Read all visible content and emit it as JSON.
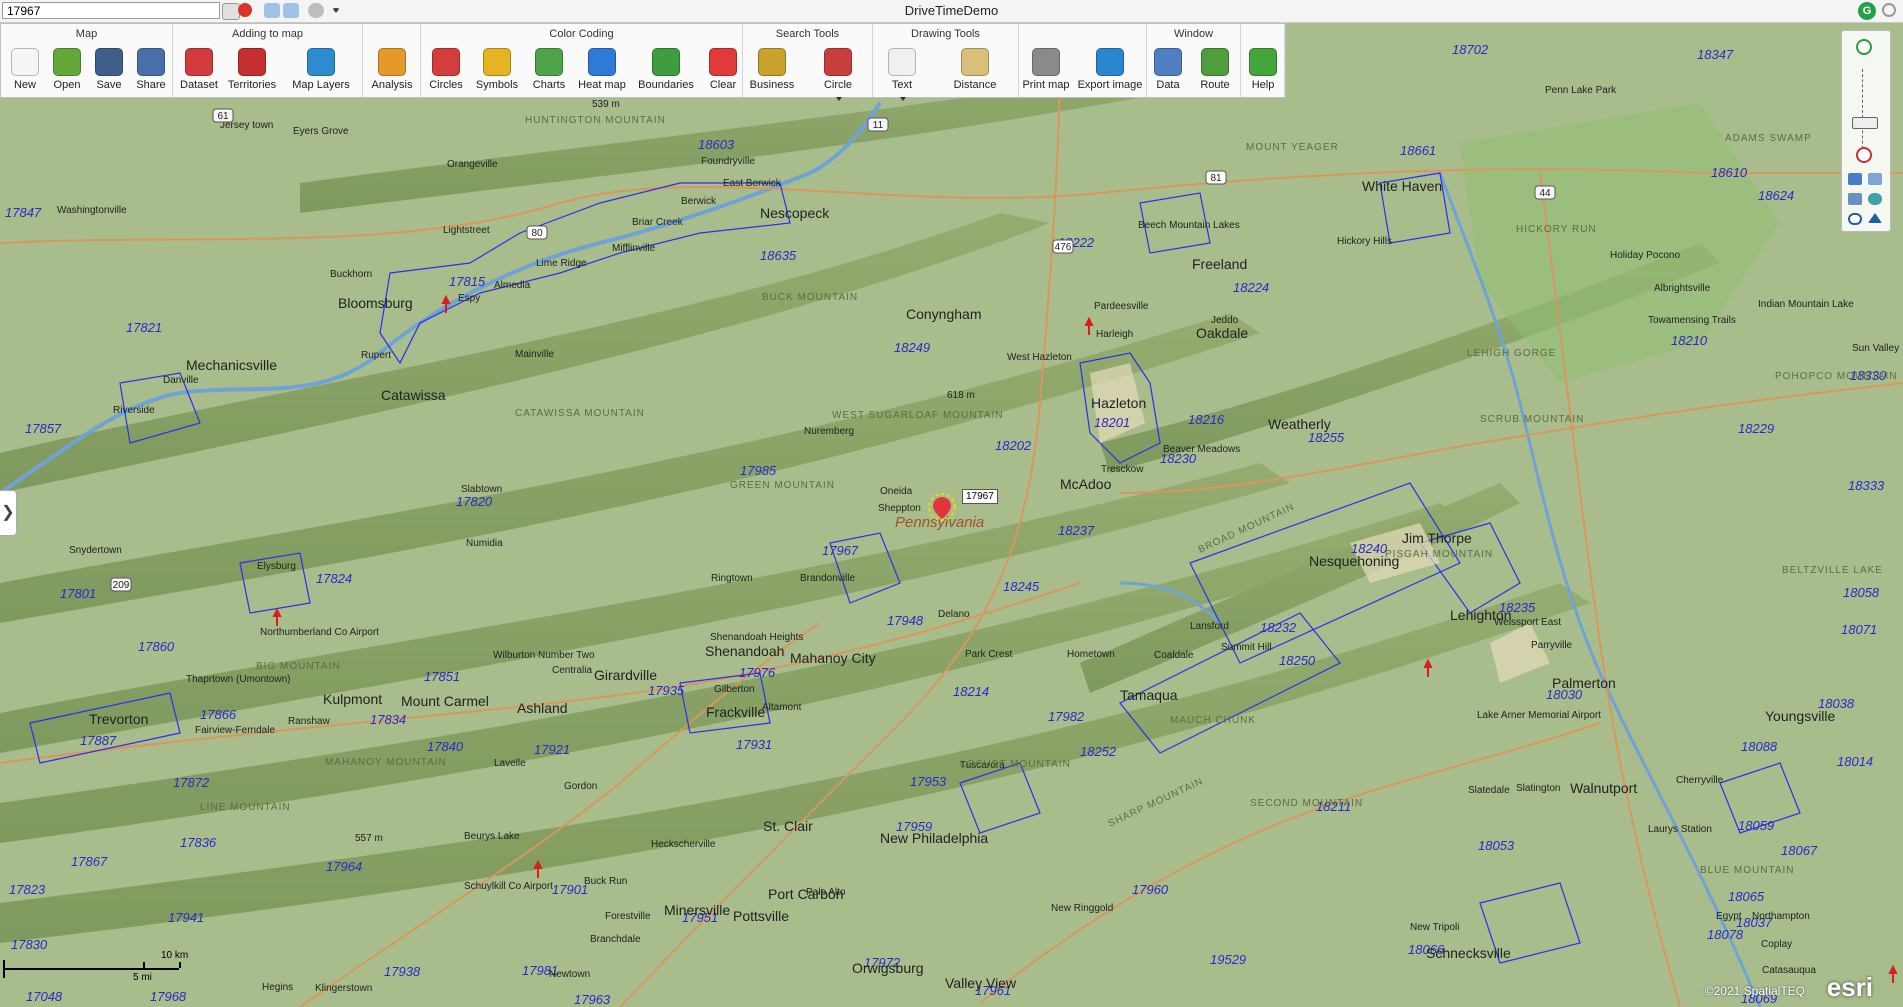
{
  "app": {
    "title": "DriveTimeDemo",
    "user_initial": "G",
    "search_value": "17967"
  },
  "ribbon": {
    "groups": [
      {
        "title": "Map",
        "buttons": [
          "New",
          "Open",
          "Save",
          "Share"
        ]
      },
      {
        "title": "Adding to map",
        "buttons": [
          "Dataset",
          "Territories",
          "Map Layers"
        ]
      },
      {
        "title": "",
        "buttons": [
          "Analysis"
        ]
      },
      {
        "title": "Color Coding",
        "buttons": [
          "Circles",
          "Symbols",
          "Charts",
          "Heat map",
          "Boundaries",
          "Clear"
        ]
      },
      {
        "title": "Search Tools",
        "buttons": [
          "Business",
          "Circle"
        ]
      },
      {
        "title": "Drawing Tools",
        "buttons": [
          "Text",
          "Distance"
        ]
      },
      {
        "title": "",
        "buttons": [
          "Print map",
          "Export image"
        ]
      },
      {
        "title": "Window",
        "buttons": [
          "Data",
          "Route"
        ]
      },
      {
        "title": "",
        "buttons": [
          "Help"
        ]
      }
    ]
  },
  "map": {
    "state_label": "Pennsylvania",
    "selected_marker_label": "17967",
    "zip_labels": [
      "18702",
      "18347",
      "18603",
      "18661",
      "18610",
      "18624",
      "17847",
      "18635",
      "18222",
      "18224",
      "17815",
      "17821",
      "18249",
      "18210",
      "18330",
      "17857",
      "18201",
      "18229",
      "18216",
      "18255",
      "18202",
      "18230",
      "17985",
      "17820",
      "18237",
      "18333",
      "17967",
      "17824",
      "18245",
      "18240",
      "17801",
      "18235",
      "18058",
      "17860",
      "17948",
      "18232",
      "18071",
      "17851",
      "17976",
      "18250",
      "18030",
      "17935",
      "17866",
      "18214",
      "18038",
      "17834",
      "17887",
      "17840",
      "17921",
      "17931",
      "17982",
      "18088",
      "18252",
      "18014",
      "17872",
      "17953",
      "18059",
      "18211",
      "17836",
      "17959",
      "18053",
      "18067",
      "17867",
      "17964",
      "17823",
      "17901",
      "18065",
      "17941",
      "17960",
      "18037",
      "17830",
      "17951",
      "18078",
      "18066",
      "17938",
      "17981",
      "17972",
      "19529",
      "18069",
      "17048",
      "17968",
      "17963",
      "17961"
    ],
    "place_labels": [
      "Jersey town",
      "Eyers Grove",
      "Orangeville",
      "Foundryville",
      "East Berwick",
      "Berwick",
      "Nescopeck",
      "Briar Creek",
      "Mifflinville",
      "Lime Ridge",
      "Almedia",
      "Espy",
      "Bloomsburg",
      "Lightstreet",
      "Buckhorn",
      "Washingtonville",
      "Mechanicsville",
      "Danville",
      "Riverside",
      "Rupert",
      "Catawissa",
      "Mainville",
      "Conyngham",
      "West Hazleton",
      "Hazleton",
      "Harleigh",
      "Pardeesville",
      "Beech Mountain Lakes",
      "Freeland",
      "Jeddo",
      "Oakdale",
      "White Haven",
      "Hickory Hills",
      "Penn Lake Park",
      "Holiday Pocono",
      "Albrightsville",
      "Towamensing Trails",
      "Indian Mountain Lake",
      "Sun Valley",
      "Weatherly",
      "Beaver Meadows",
      "Nuremberg",
      "Oneida",
      "Sheppton",
      "McAdoo",
      "Tresckow",
      "Slabtown",
      "Numidia",
      "Snydertown",
      "Elysburg",
      "Ringtown",
      "Brandonville",
      "Delano",
      "Nesquehoning",
      "Jim Thorpe",
      "Lehighton",
      "Weissport East",
      "Parryville",
      "Shenandoah Heights",
      "Shenandoah",
      "Mahanoy City",
      "Park Crest",
      "Hometown",
      "Coaldale",
      "Lansford",
      "Summit Hill",
      "Tamaqua",
      "Northumberland Co Airport",
      "Wilburton Number Two",
      "Centralia",
      "Girardville",
      "Gilberton",
      "Frackville",
      "Altamont",
      "Thaprtown (Umontown)",
      "Kulpmont",
      "Mount Carmel",
      "Ashland",
      "Ranshaw",
      "Fairview-Ferndale",
      "Trevorton",
      "Lavelle",
      "Gordon",
      "Tuscarora",
      "Palmerton",
      "Youngsville",
      "Slatedale",
      "Slatington",
      "Walnutport",
      "Cherryville",
      "Lake Arner Memorial Airport",
      "Laurys Station",
      "St. Clair",
      "New Philadelphia",
      "Beurys Lake",
      "Buck Run",
      "Heckscherville",
      "Port Carbon",
      "Palo Alto",
      "Pottsville",
      "Forestville",
      "Minersville",
      "Schuylkill Co Airport",
      "New Ringgold",
      "New Tripoli",
      "Schnecksville",
      "Egypt",
      "Northampton",
      "Coplay",
      "Catasauqua",
      "Branchdale",
      "Newtown",
      "Orwigsburg",
      "Valley View",
      "Hegins",
      "Klingerstown"
    ],
    "mountain_labels": [
      "HUNTINGTON MOUNTAIN",
      "BUCK MOUNTAIN",
      "CATAWISSA MOUNTAIN",
      "WEST SUGARLOAF MOUNTAIN",
      "GREEN MOUNTAIN",
      "BROAD MOUNTAIN",
      "PISGAH MOUNTAIN",
      "BIG MOUNTAIN",
      "MAHANOY MOUNTAIN",
      "LOCUST MOUNTAIN",
      "SHARP MOUNTAIN",
      "LINE MOUNTAIN",
      "MAUCH CHUNK",
      "SECOND MOUNTAIN",
      "BLUE MOUNTAIN",
      "MOUNT YEAGER",
      "HICKORY RUN",
      "LEHIGH GORGE",
      "SCRUB MOUNTAIN",
      "BELTZVILLE LAKE",
      "POHOPCO MOUNTAIN",
      "ADAMS SWAMP"
    ],
    "elevations": [
      "539 m",
      "618 m",
      "557 m"
    ],
    "highways": [
      "11",
      "80",
      "81",
      "476",
      "44",
      "61",
      "209"
    ],
    "scale": {
      "km": "10 km",
      "mi": "5 mi"
    },
    "attribution": "©2021 SpatialTEQ",
    "esri": "esri"
  }
}
